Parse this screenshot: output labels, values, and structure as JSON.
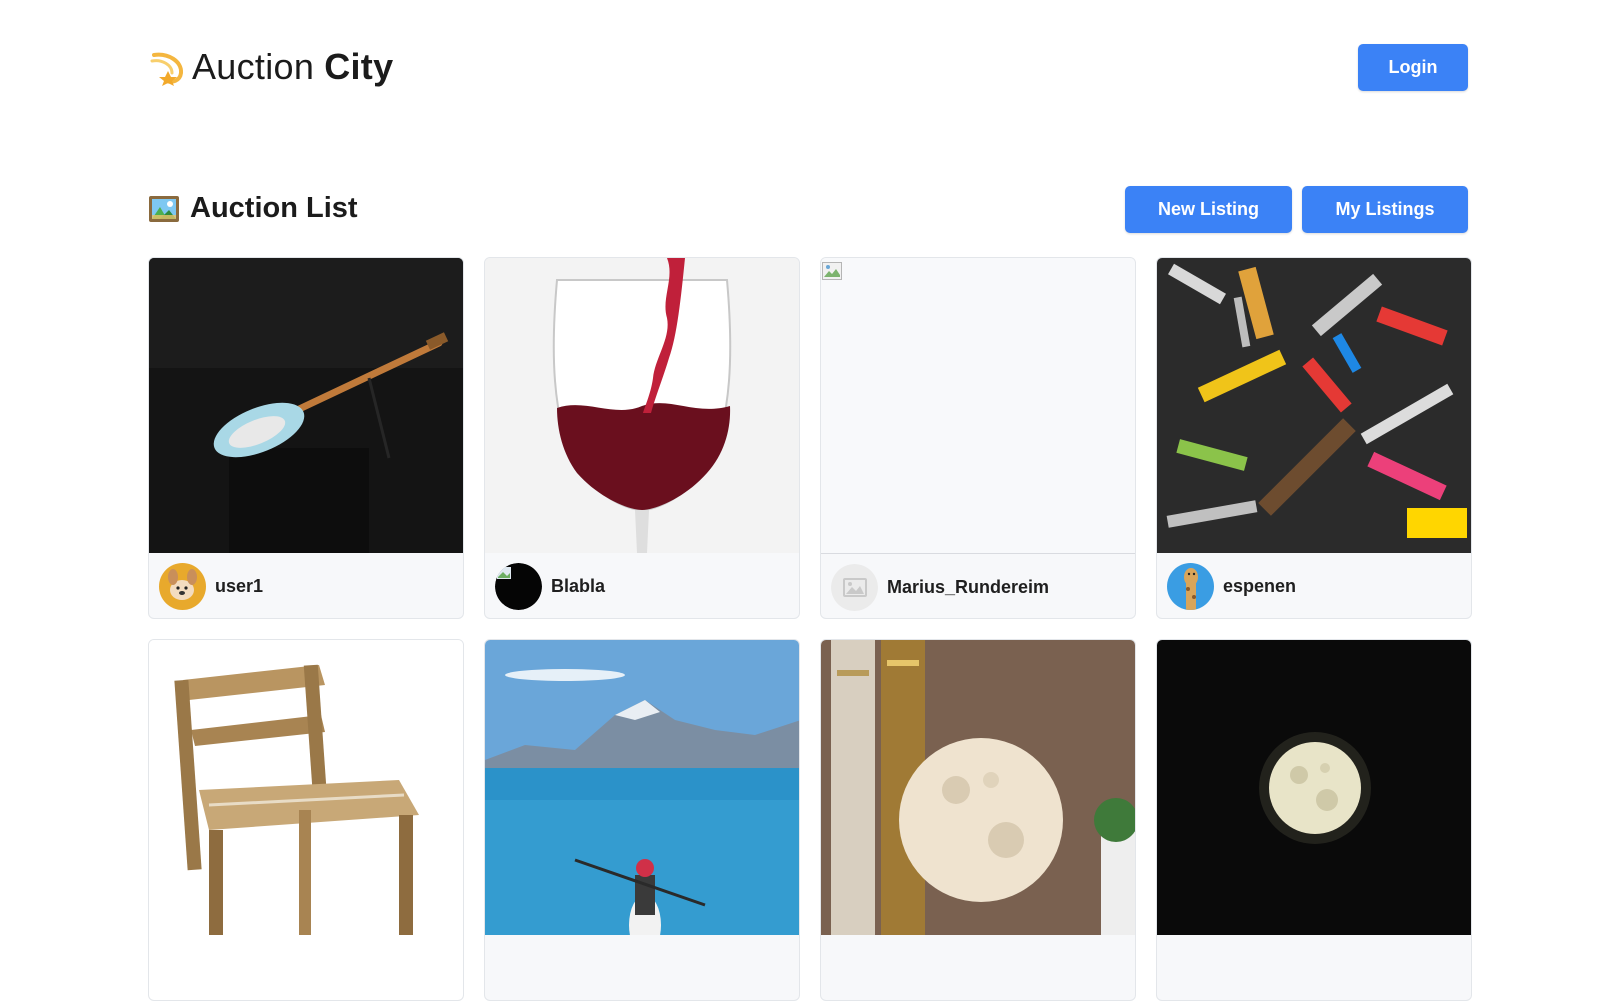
{
  "header": {
    "logo_word_1": "Auction",
    "logo_word_2": "City",
    "login_label": "Login"
  },
  "list": {
    "title": "Auction List",
    "new_listing_label": "New Listing",
    "my_listings_label": "My Listings"
  },
  "listings": [
    {
      "username": "user1",
      "image": "guitar-photo",
      "avatar": "dog-avatar"
    },
    {
      "username": "Blabla",
      "image": "wine-glass-photo",
      "avatar": "black-circle-avatar"
    },
    {
      "username": "Marius_Rundereim",
      "image": "broken-image",
      "avatar": "placeholder-avatar"
    },
    {
      "username": "espenen",
      "image": "tools-pile-photo",
      "avatar": "giraffe-avatar"
    },
    {
      "username": "",
      "image": "wooden-chair-photo",
      "avatar": ""
    },
    {
      "username": "",
      "image": "kayak-lake-photo",
      "avatar": ""
    },
    {
      "username": "",
      "image": "moon-lamp-photo",
      "avatar": ""
    },
    {
      "username": "",
      "image": "full-moon-photo",
      "avatar": ""
    }
  ],
  "colors": {
    "accent": "#3b82f6",
    "card_bg": "#f7f8fa",
    "card_border": "#e3e6ea",
    "logo_icon": "#f4b63f"
  }
}
